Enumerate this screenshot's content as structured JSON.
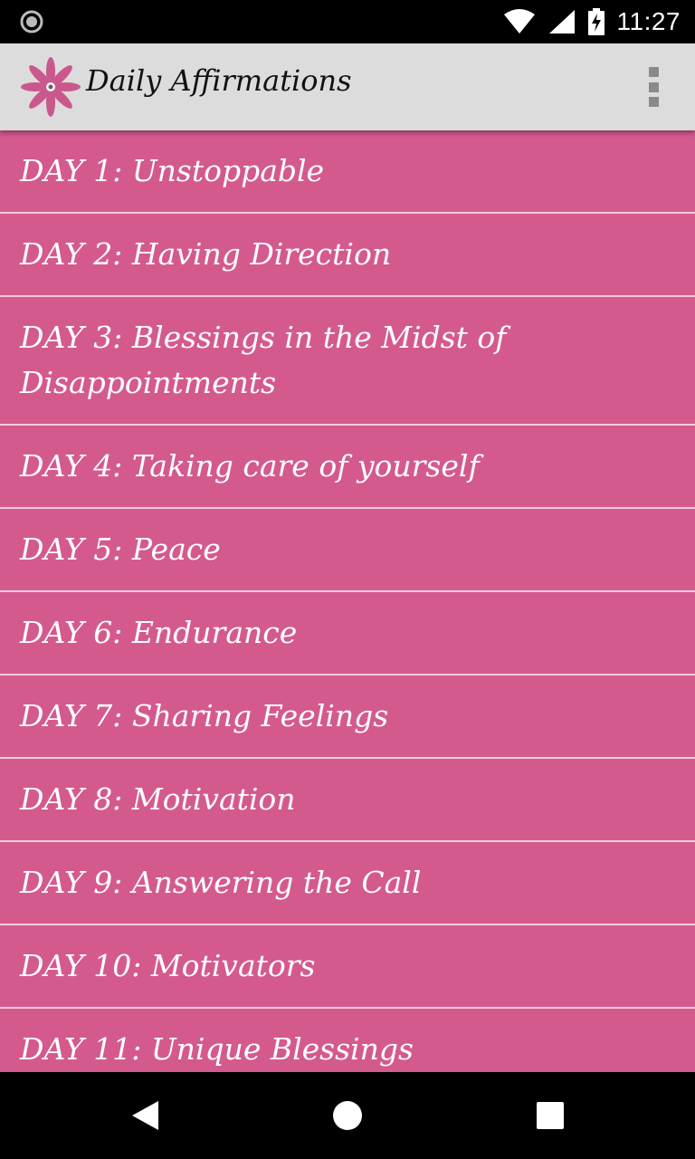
{
  "status_bar": {
    "time": "11:27",
    "icons": [
      "circle-record-icon",
      "wifi-icon",
      "signal-icon",
      "battery-charging-icon"
    ]
  },
  "app_bar": {
    "title": "Daily Affirmations",
    "logo_icon": "flower-logo-icon",
    "menu_icon": "overflow-menu-icon"
  },
  "list": {
    "items": [
      {
        "label": "DAY 1: Unstoppable"
      },
      {
        "label": "DAY 2: Having Direction"
      },
      {
        "label": "DAY 3: Blessings in the Midst of Disappointments"
      },
      {
        "label": "DAY 4: Taking care of yourself"
      },
      {
        "label": "DAY 5: Peace"
      },
      {
        "label": "DAY 6: Endurance"
      },
      {
        "label": "DAY 7: Sharing Feelings"
      },
      {
        "label": "DAY 8: Motivation"
      },
      {
        "label": "DAY 9: Answering the Call"
      },
      {
        "label": "DAY 10: Motivators"
      },
      {
        "label": "DAY 11: Unique Blessings"
      }
    ]
  },
  "nav_bar": {
    "icons": [
      "back-icon",
      "home-icon",
      "recents-icon"
    ]
  },
  "colors": {
    "list_background": "#d45a8e",
    "divider": "#f3cbdc",
    "app_bar": "#dcdcdc"
  }
}
